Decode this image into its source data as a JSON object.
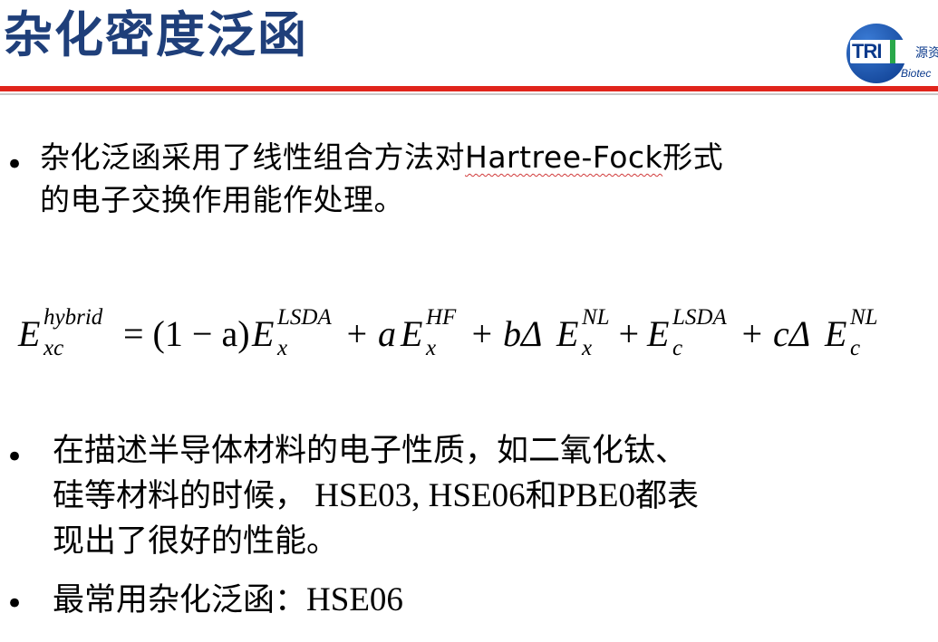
{
  "slide": {
    "title": "杂化密度泛函",
    "logo": {
      "cn_text": "源资",
      "en_text": "Biotec",
      "mark": "TRI"
    },
    "bullets": [
      {
        "line1_pre": "杂化泛函采用了线性组合方法对",
        "line1_term": "Hartree-Fock",
        "line1_post": "形式",
        "line2": "的电子交换作用能作处理。"
      },
      {
        "line1": "在描述半导体材料的电子性质，如二氧化钛、",
        "line2_pre": "硅等材料的时候，",
        "line2_latin": " HSE03, HSE06",
        "line2_mid": "和",
        "line2_latin2": "PBE0",
        "line2_post": "都表",
        "line3": "现出了很好的性能。"
      },
      {
        "line1_pre": "最常用杂化泛函：",
        "line1_latin": "HSE06"
      }
    ],
    "formula": {
      "lhs_base": "E",
      "lhs_sup": "hybrid",
      "lhs_sub": "xc",
      "eq": "= (1 − a)",
      "t1_base": "E",
      "t1_sup": "LSDA",
      "t1_sub": "x",
      "t2_pre": "+ a",
      "t2_base": "E",
      "t2_sup": "HF",
      "t2_sub": "x",
      "t3_pre": "+ bΔ",
      "t3_base": "E",
      "t3_sup": "NL",
      "t3_sub": "x",
      "t4_pre": "+ ",
      "t4_base": "E",
      "t4_sup": "LSDA",
      "t4_sub": "c",
      "t5_pre": "+ cΔ",
      "t5_base": "E",
      "t5_sup": "NL",
      "t5_sub": "c"
    }
  }
}
